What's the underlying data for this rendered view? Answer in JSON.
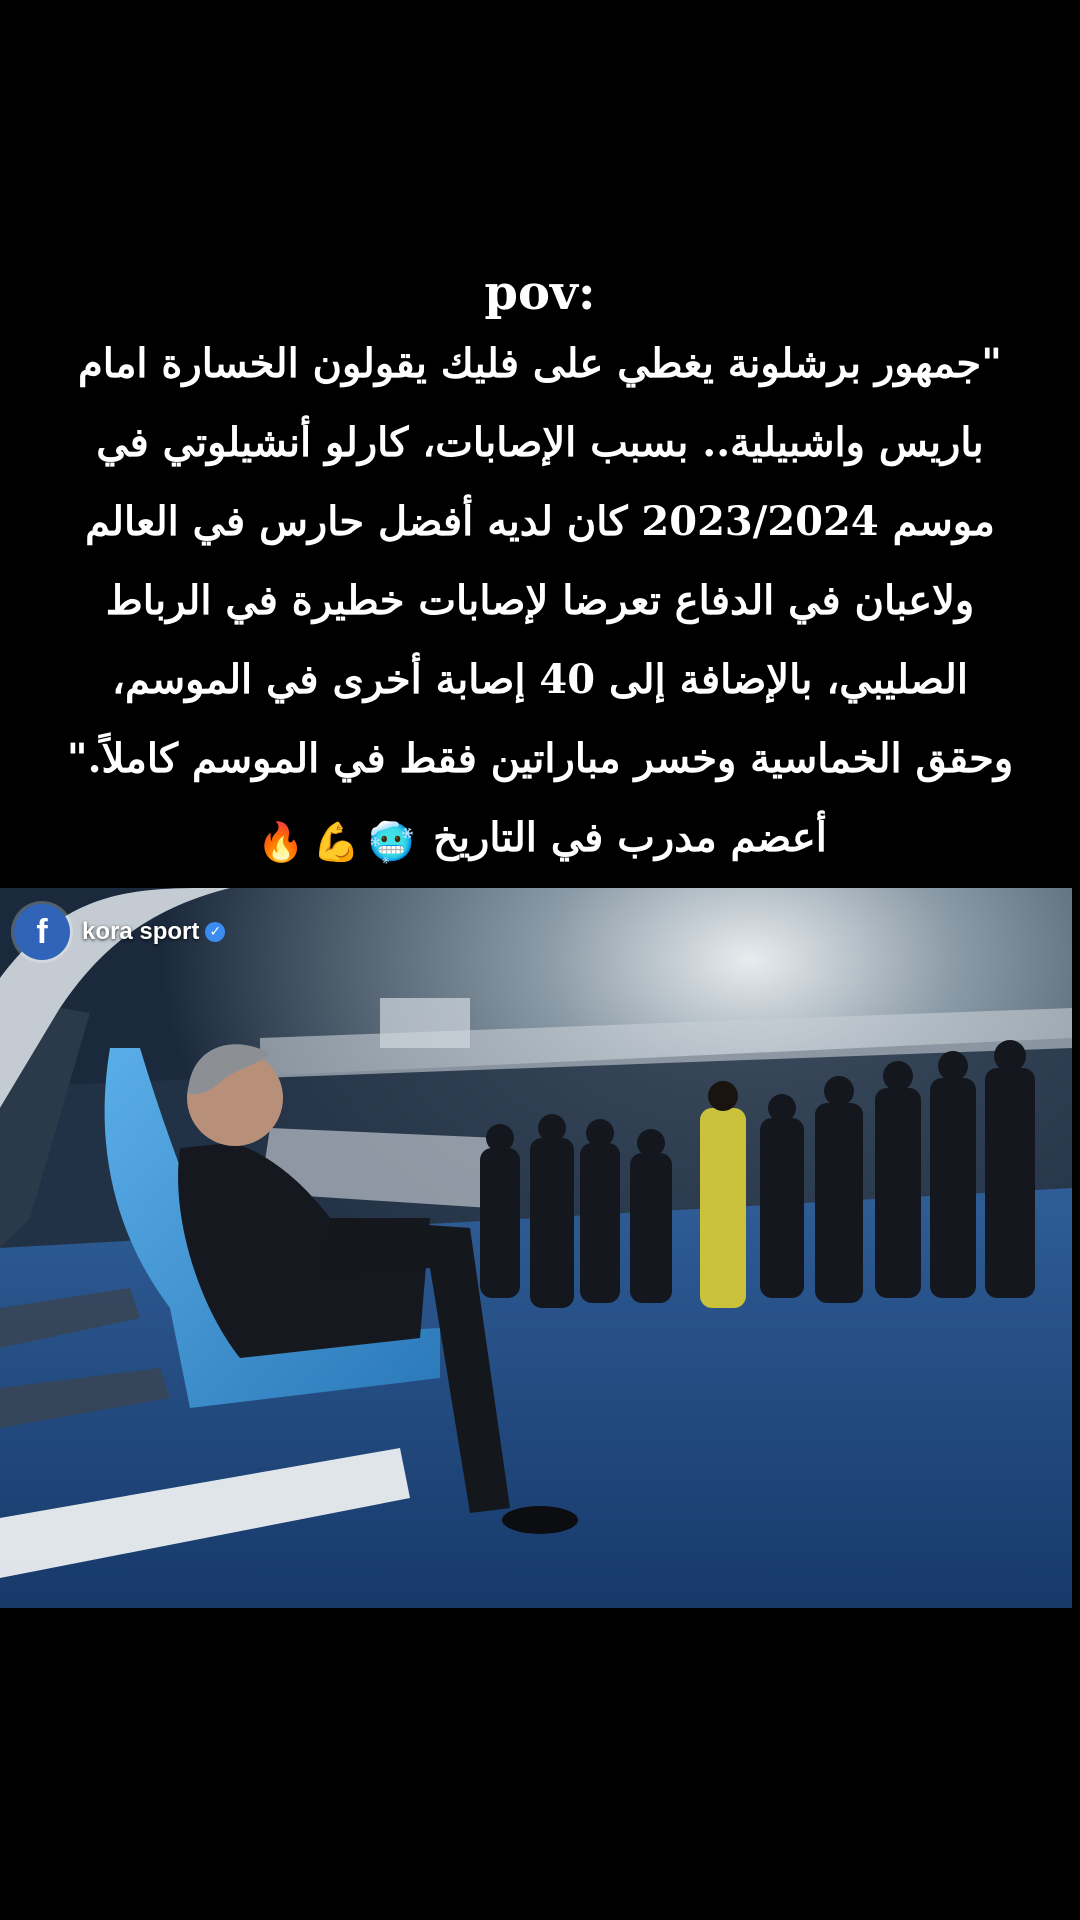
{
  "caption": {
    "pov": "pov:",
    "lines": [
      "\"جمهور برشلونة يغطي على فليك يقولون الخسارة امام",
      "باريس واشبيلية.. بسبب الإصابات، كارلو أنشيلوتي في",
      "موسم 2023/2024 كان لديه أفضل حارس في العالم",
      "ولاعبان في الدفاع تعرضا لإصابات خطيرة في الرباط",
      "الصليبي، بالإضافة إلى 40 إصابة أخرى في الموسم،",
      "وحقق الخماسية وخسر مباراتين فقط في الموسم كاملاً.\"",
      "أعضم مدرب في التاريخ"
    ],
    "emojis": [
      "🥶",
      "💪",
      "🔥"
    ]
  },
  "photo": {
    "watermark": {
      "platform_icon": "facebook-icon",
      "name": "kora sport",
      "verified_icon": "verified-check-icon"
    }
  },
  "colors": {
    "background": "#000000",
    "text": "#ffffff",
    "facebook": "#2f64b8",
    "seat": "#3a8fd0",
    "pitch": "#1f4a86"
  }
}
